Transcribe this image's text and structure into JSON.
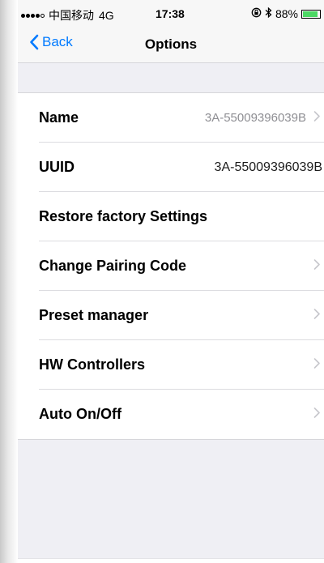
{
  "status_bar": {
    "carrier": "中国移动",
    "network": "4G",
    "time": "17:38",
    "battery_percent": "88%",
    "battery_level": 0.88,
    "battery_color": "#4cd964",
    "icons": [
      "signal-dots-icon",
      "rotation-lock-icon",
      "bluetooth-icon",
      "battery-icon"
    ]
  },
  "nav": {
    "back_label": "Back",
    "title": "Options",
    "accent": "#007aff"
  },
  "options": [
    {
      "label": "Name",
      "value": "3A-55009396039B",
      "has_chevron": true
    },
    {
      "label": "UUID",
      "value": "3A-55009396039B",
      "has_chevron": false
    },
    {
      "label": "Restore factory Settings",
      "value": "",
      "has_chevron": false
    },
    {
      "label": "Change Pairing Code",
      "value": "",
      "has_chevron": true
    },
    {
      "label": "Preset manager",
      "value": "",
      "has_chevron": true
    },
    {
      "label": "HW Controllers",
      "value": "",
      "has_chevron": true
    },
    {
      "label": "Auto On/Off",
      "value": "",
      "has_chevron": true
    }
  ]
}
